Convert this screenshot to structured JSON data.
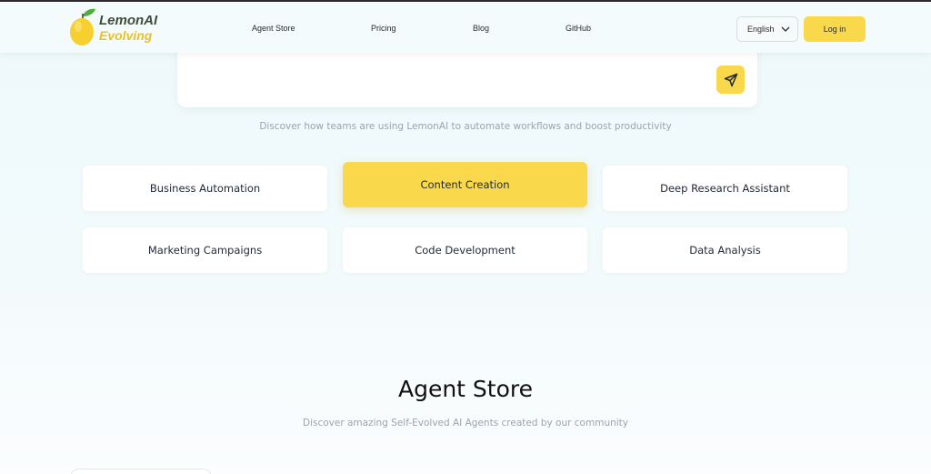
{
  "colors": {
    "accent": "#fad84b",
    "background": "#eef9fb",
    "text": "#1f2937",
    "muted": "#9ca3af"
  },
  "header": {
    "logo": {
      "name": "LemonAI",
      "subtitle": "Evolving",
      "icon": "lemon-icon"
    },
    "nav": [
      {
        "label": "Agent Store"
      },
      {
        "label": "Pricing"
      },
      {
        "label": "Blog"
      },
      {
        "label": "GitHub"
      }
    ],
    "language": {
      "value": "English",
      "icon": "chevron-down-icon"
    },
    "login_label": "Log in"
  },
  "composer": {
    "send_icon": "send-icon"
  },
  "use_cases": {
    "description": "Discover how teams are using LemonAI to automate workflows and boost productivity",
    "items": [
      {
        "label": "Business Automation",
        "active": false
      },
      {
        "label": "Content Creation",
        "active": true
      },
      {
        "label": "Deep Research Assistant",
        "active": false
      },
      {
        "label": "Marketing Campaigns",
        "active": false
      },
      {
        "label": "Code Development",
        "active": false
      },
      {
        "label": "Data Analysis",
        "active": false
      }
    ]
  },
  "agent_store": {
    "title": "Agent Store",
    "subtitle": "Discover amazing Self-Evolved AI Agents created by our community"
  }
}
